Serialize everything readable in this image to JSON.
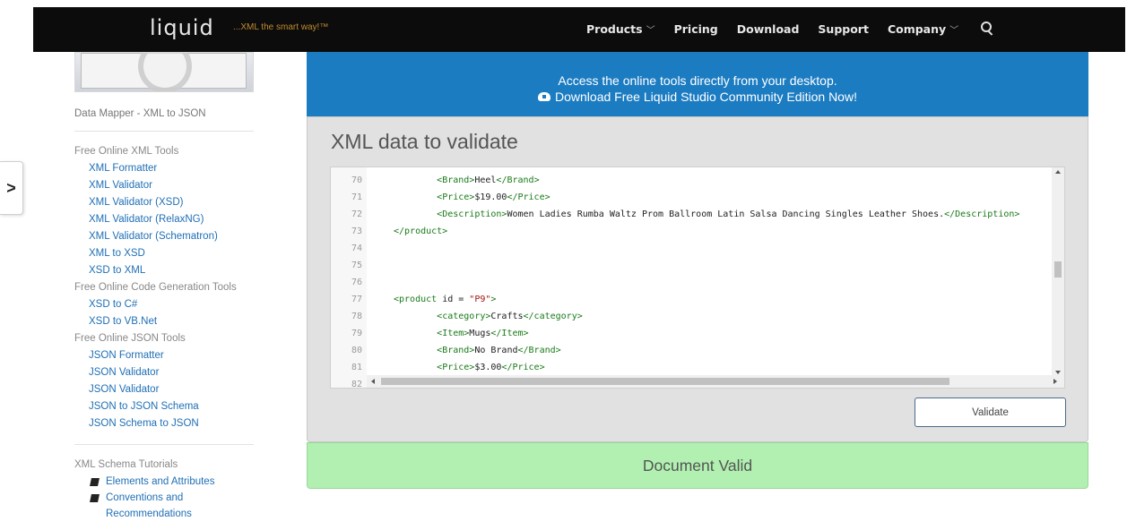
{
  "header": {
    "logo_text": "liquid",
    "tagline": "...XML the smart way!™",
    "nav": [
      {
        "label": "Products",
        "dropdown": true
      },
      {
        "label": "Pricing",
        "dropdown": false
      },
      {
        "label": "Download",
        "dropdown": false
      },
      {
        "label": "Support",
        "dropdown": false
      },
      {
        "label": "Company",
        "dropdown": true
      }
    ],
    "search_icon": "search-icon"
  },
  "sidebar": {
    "video_caption": "Data Mapper - XML to JSON",
    "groups": [
      {
        "title": "Free Online XML Tools",
        "links": [
          "XML Formatter",
          "XML Validator",
          "XML Validator (XSD)",
          "XML Validator (RelaxNG)",
          "XML Validator (Schematron)",
          "XML to XSD",
          "XSD to XML"
        ]
      },
      {
        "title": "Free Online Code Generation Tools",
        "links": [
          "XSD to C#",
          "XSD to VB.Net"
        ]
      },
      {
        "title": "Free Online JSON Tools",
        "links": [
          "JSON Formatter",
          "JSON Validator",
          "JSON Validator",
          "JSON to JSON Schema",
          "JSON Schema to JSON"
        ]
      }
    ],
    "tutorials_title": "XML Schema Tutorials",
    "tutorials": [
      {
        "lines": [
          "Elements and Attributes"
        ]
      },
      {
        "lines": [
          "Conventions and",
          "Recommendations"
        ]
      }
    ],
    "side_toggle": ">"
  },
  "banner": {
    "line1": "Access the online tools directly from your desktop.",
    "line2": "Download Free Liquid Studio Community Edition Now!"
  },
  "main": {
    "title": "XML data to validate",
    "code_lines": [
      {
        "n": "70",
        "indent": "        ",
        "parts": [
          [
            "tag",
            "<Brand>"
          ],
          [
            "txt",
            "Heel"
          ],
          [
            "tag",
            "</Brand>"
          ]
        ]
      },
      {
        "n": "71",
        "indent": "        ",
        "parts": [
          [
            "tag",
            "<Price>"
          ],
          [
            "txt",
            "$19.00"
          ],
          [
            "tag",
            "</Price>"
          ]
        ]
      },
      {
        "n": "72",
        "indent": "        ",
        "parts": [
          [
            "tag",
            "<Description>"
          ],
          [
            "txt",
            "Women Ladies Rumba Waltz Prom Ballroom Latin Salsa Dancing Singles Leather Shoes."
          ],
          [
            "tag",
            "</Description>"
          ]
        ]
      },
      {
        "n": "73",
        "indent": "",
        "parts": [
          [
            "tag",
            "</product>"
          ]
        ]
      },
      {
        "n": "74",
        "indent": "",
        "parts": []
      },
      {
        "n": "75",
        "indent": "",
        "parts": []
      },
      {
        "n": "76",
        "indent": "",
        "parts": []
      },
      {
        "n": "77",
        "indent": "",
        "parts": [
          [
            "tag",
            "<product "
          ],
          [
            "txt",
            "id = "
          ],
          [
            "val",
            "\"P9\""
          ],
          [
            "tag",
            ">"
          ]
        ]
      },
      {
        "n": "78",
        "indent": "        ",
        "parts": [
          [
            "tag",
            "<category>"
          ],
          [
            "txt",
            "Crafts"
          ],
          [
            "tag",
            "</category>"
          ]
        ]
      },
      {
        "n": "79",
        "indent": "        ",
        "parts": [
          [
            "tag",
            "<Item>"
          ],
          [
            "txt",
            "Mugs"
          ],
          [
            "tag",
            "</Item>"
          ]
        ]
      },
      {
        "n": "80",
        "indent": "        ",
        "parts": [
          [
            "tag",
            "<Brand>"
          ],
          [
            "txt",
            "No Brand"
          ],
          [
            "tag",
            "</Brand>"
          ]
        ]
      },
      {
        "n": "81",
        "indent": "        ",
        "parts": [
          [
            "tag",
            "<Price>"
          ],
          [
            "txt",
            "$3.00"
          ],
          [
            "tag",
            "</Price>"
          ]
        ]
      },
      {
        "n": "82",
        "indent": "",
        "parts": []
      }
    ],
    "validate_label": "Validate",
    "result": "Document Valid"
  },
  "colors": {
    "banner": "#1c7cc2",
    "result_bg": "#b1f0b1",
    "link": "#1f6fb5",
    "xml_tag": "#1a7a1a"
  }
}
